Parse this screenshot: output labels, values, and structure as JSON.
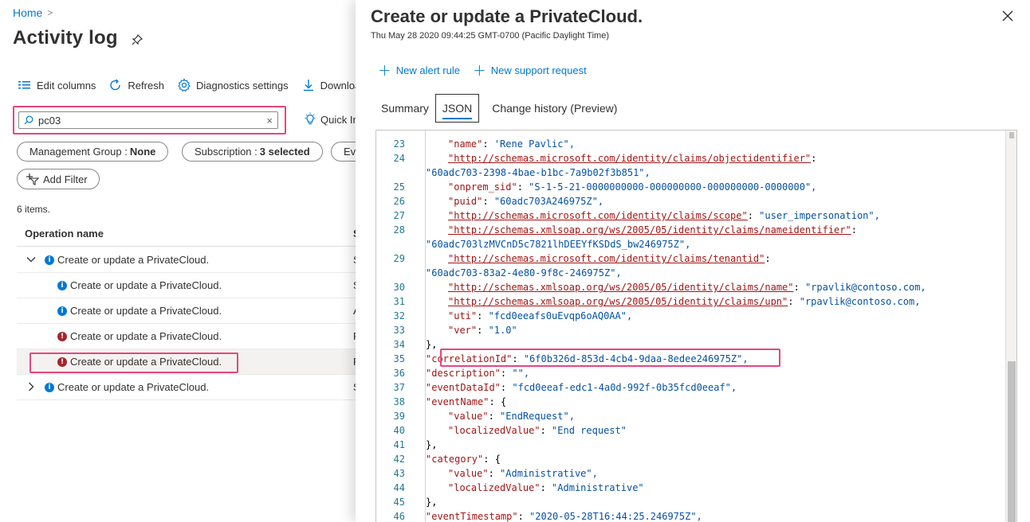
{
  "breadcrumb": {
    "home": "Home",
    "separator": ">"
  },
  "page": {
    "title": "Activity log"
  },
  "toolbar": {
    "edit_columns": "Edit columns",
    "refresh": "Refresh",
    "diagnostics": "Diagnostics settings",
    "download": "Downloa"
  },
  "search": {
    "value": "pc03",
    "clear": "×"
  },
  "quick_insights": "Quick In",
  "filters": {
    "management_group_label": "Management Group :",
    "management_group_value": "None",
    "subscription_label": "Subscription :",
    "subscription_value": "3 selected",
    "event_pill": "Ev",
    "add_filter": "Add Filter"
  },
  "results": {
    "count": "6 items.",
    "column_header": "Operation name",
    "column_header_2": "S",
    "rows": [
      {
        "label": "Create or update a PrivateCloud.",
        "status": "info",
        "col2": "S"
      },
      {
        "label": "Create or update a PrivateCloud.",
        "status": "info",
        "col2": "S"
      },
      {
        "label": "Create or update a PrivateCloud.",
        "status": "info",
        "col2": "A"
      },
      {
        "label": "Create or update a PrivateCloud.",
        "status": "error",
        "col2": "F"
      },
      {
        "label": "Create or update a PrivateCloud.",
        "status": "error",
        "col2": "F"
      },
      {
        "label": "Create or update a PrivateCloud.",
        "status": "info",
        "col2": "S"
      }
    ]
  },
  "panel": {
    "title": "Create or update a PrivateCloud.",
    "subtitle": "Thu May 28 2020 09:44:25 GMT-0700 (Pacific Daylight Time)",
    "actions": {
      "new_alert_rule": "New alert rule",
      "new_support_request": "New support request"
    },
    "tabs": [
      "Summary",
      "JSON",
      "Change history (Preview)"
    ],
    "active_tab": "JSON"
  },
  "code": {
    "l23": {
      "n": "23",
      "key": "\"name\"",
      "val": "'Rene Pavlic\","
    },
    "l24": {
      "n": "24",
      "url": "\"http://schemas.microsoft.com/identity/claims/objectidentifier\"",
      "wrap": "\"60adc703-2398-4bae-b1bc-7a9b02f3b851\","
    },
    "l25": {
      "n": "25",
      "key": "\"onprem_sid\"",
      "val": "\"S-1-5-21-0000000000-000000000-000000000-0000000\","
    },
    "l26": {
      "n": "26",
      "key": "\"puid\"",
      "val": "\"60adc703A246975Z\","
    },
    "l27": {
      "n": "27",
      "url": "\"http://schemas.microsoft.com/identity/claims/scope\"",
      "val": "\"user_impersonation\","
    },
    "l28": {
      "n": "28",
      "url": "\"http://schemas.xmlsoap.org/ws/2005/05/identity/claims/nameidentifier\"",
      "wrap": "\"60adc703lzMVCnD5c7821lhDEEYfKSDdS_bw246975Z\","
    },
    "l29": {
      "n": "29",
      "url": "\"http://schemas.microsoft.com/identity/claims/tenantid\"",
      "wrap": "\"60adc703-83a2-4e80-9f8c-246975Z\","
    },
    "l30": {
      "n": "30",
      "url": "\"http://schemas.xmlsoap.org/ws/2005/05/identity/claims/name\"",
      "val": "\"rpavlik@contoso.com,"
    },
    "l31": {
      "n": "31",
      "url": "\"http://schemas.xmlsoap.org/ws/2005/05/identity/claims/upn\"",
      "val": "\"rpavlik@contoso.com,"
    },
    "l32": {
      "n": "32",
      "key": "\"uti\"",
      "val": "\"fcd0eeafs0uEvqp6oAQ0AA\","
    },
    "l33": {
      "n": "33",
      "key": "\"ver\"",
      "val": "\"1.0\""
    },
    "l34": {
      "n": "34",
      "text": "},"
    },
    "l35": {
      "n": "35",
      "key": "\"correlationId\"",
      "val": "\"6f0b326d-853d-4cb4-9daa-8edee246975Z\","
    },
    "l36": {
      "n": "36",
      "key": "\"description\"",
      "val": "\"\","
    },
    "l37": {
      "n": "37",
      "key": "\"eventDataId\"",
      "val": "\"fcd0eeaf-edc1-4a0d-992f-0b35fcd0eeaf\","
    },
    "l38": {
      "n": "38",
      "key": "\"eventName\"",
      "text": "{"
    },
    "l39": {
      "n": "39",
      "key": "\"value\"",
      "val": "\"EndRequest\","
    },
    "l40": {
      "n": "40",
      "key": "\"localizedValue\"",
      "val": "\"End request\""
    },
    "l41": {
      "n": "41",
      "text": "},"
    },
    "l42": {
      "n": "42",
      "key": "\"category\"",
      "text": "{"
    },
    "l43": {
      "n": "43",
      "key": "\"value\"",
      "val": "\"Administrative\","
    },
    "l44": {
      "n": "44",
      "key": "\"localizedValue\"",
      "val": "\"Administrative\""
    },
    "l45": {
      "n": "45",
      "text": "},"
    },
    "l46": {
      "n": "46",
      "key": "\"eventTimestamp\"",
      "val": "\"2020-05-28T16:44:25.246975Z\","
    }
  },
  "colors": {
    "accent": "#0078d4",
    "highlight": "#e8457f",
    "error": "#a4262c"
  }
}
